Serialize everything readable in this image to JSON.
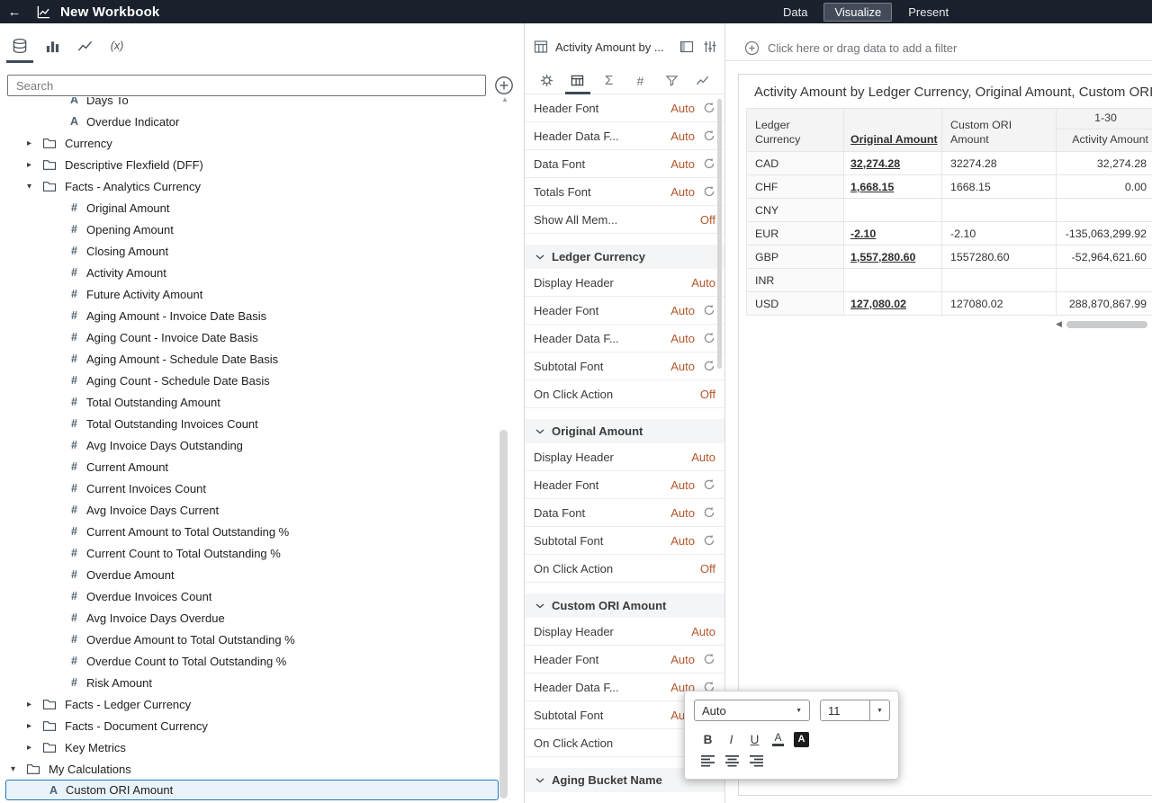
{
  "icons": {
    "back": "←",
    "expand": "▸",
    "collapse": "▾",
    "dropdown": "▼",
    "scroll_up": "▲",
    "scroll_left": "◀",
    "measure": "#",
    "attribute": "A",
    "fx": "(x)",
    "sigma": "Σ",
    "hash": "#"
  },
  "accent_colors": {
    "value_orange": "#b2572b",
    "selection_blue": "#2379bf",
    "topbar": "#1b212c"
  },
  "topbar": {
    "title": "New Workbook",
    "nav": [
      {
        "label": "Data",
        "active": false
      },
      {
        "label": "Visualize",
        "active": true
      },
      {
        "label": "Present",
        "active": false
      }
    ]
  },
  "data_panel": {
    "search_placeholder": "Search",
    "tree": [
      {
        "kind": "attr",
        "label": "Days To",
        "pad": 76
      },
      {
        "kind": "attr",
        "label": "Overdue Indicator",
        "pad": 76
      },
      {
        "kind": "folder",
        "label": "Currency",
        "pad": 30,
        "expanded": false
      },
      {
        "kind": "folder",
        "label": "Descriptive Flexfield (DFF)",
        "pad": 30,
        "expanded": false
      },
      {
        "kind": "folder",
        "label": "Facts - Analytics Currency",
        "pad": 30,
        "expanded": true
      },
      {
        "kind": "measure",
        "label": "Original Amount",
        "pad": 76
      },
      {
        "kind": "measure",
        "label": "Opening Amount",
        "pad": 76
      },
      {
        "kind": "measure",
        "label": "Closing Amount",
        "pad": 76
      },
      {
        "kind": "measure",
        "label": "Activity Amount",
        "pad": 76
      },
      {
        "kind": "measure",
        "label": "Future Activity Amount",
        "pad": 76
      },
      {
        "kind": "measure",
        "label": "Aging Amount - Invoice Date Basis",
        "pad": 76
      },
      {
        "kind": "measure",
        "label": "Aging Count - Invoice Date Basis",
        "pad": 76
      },
      {
        "kind": "measure",
        "label": "Aging Amount - Schedule Date Basis",
        "pad": 76
      },
      {
        "kind": "measure",
        "label": "Aging Count - Schedule Date Basis",
        "pad": 76
      },
      {
        "kind": "measure",
        "label": "Total Outstanding Amount",
        "pad": 76
      },
      {
        "kind": "measure",
        "label": "Total Outstanding Invoices Count",
        "pad": 76
      },
      {
        "kind": "measure",
        "label": "Avg Invoice Days Outstanding",
        "pad": 76
      },
      {
        "kind": "measure",
        "label": "Current Amount",
        "pad": 76
      },
      {
        "kind": "measure",
        "label": "Current Invoices Count",
        "pad": 76
      },
      {
        "kind": "measure",
        "label": "Avg Invoice Days Current",
        "pad": 76
      },
      {
        "kind": "measure",
        "label": "Current Amount to Total Outstanding %",
        "pad": 76
      },
      {
        "kind": "measure",
        "label": "Current Count to Total Outstanding %",
        "pad": 76
      },
      {
        "kind": "measure",
        "label": "Overdue Amount",
        "pad": 76
      },
      {
        "kind": "measure",
        "label": "Overdue Invoices Count",
        "pad": 76
      },
      {
        "kind": "measure",
        "label": "Avg Invoice Days Overdue",
        "pad": 76
      },
      {
        "kind": "measure",
        "label": "Overdue Amount to Total Outstanding %",
        "pad": 76
      },
      {
        "kind": "measure",
        "label": "Overdue Count to Total Outstanding %",
        "pad": 76
      },
      {
        "kind": "measure",
        "label": "Risk Amount",
        "pad": 76
      },
      {
        "kind": "folder",
        "label": "Facts - Ledger Currency",
        "pad": 30,
        "expanded": false
      },
      {
        "kind": "folder",
        "label": "Facts - Document Currency",
        "pad": 30,
        "expanded": false
      },
      {
        "kind": "folder",
        "label": "Key Metrics",
        "pad": 30,
        "expanded": false
      },
      {
        "kind": "folder",
        "label": "My Calculations",
        "pad": 12,
        "expanded": true
      },
      {
        "kind": "attr",
        "label": "Custom ORI Amount",
        "pad": 52,
        "selected": true
      }
    ]
  },
  "props_panel": {
    "viz_title": "Activity Amount by ...",
    "rows": [
      {
        "t": "prop",
        "label": "Header Font",
        "value": "Auto",
        "reset": true
      },
      {
        "t": "prop",
        "label": "Header Data F...",
        "value": "Auto",
        "reset": true
      },
      {
        "t": "prop",
        "label": "Data Font",
        "value": "Auto",
        "reset": true
      },
      {
        "t": "prop",
        "label": "Totals Font",
        "value": "Auto",
        "reset": true
      },
      {
        "t": "prop",
        "label": "Show All Mem...",
        "value": "Off",
        "reset": false
      },
      {
        "t": "section",
        "label": "Ledger Currency"
      },
      {
        "t": "prop",
        "label": "Display Header",
        "value": "Auto",
        "reset": false
      },
      {
        "t": "prop",
        "label": "Header Font",
        "value": "Auto",
        "reset": true
      },
      {
        "t": "prop",
        "label": "Header Data F...",
        "value": "Auto",
        "reset": true
      },
      {
        "t": "prop",
        "label": "Subtotal Font",
        "value": "Auto",
        "reset": true
      },
      {
        "t": "prop",
        "label": "On Click Action",
        "value": "Off",
        "reset": false
      },
      {
        "t": "section",
        "label": "Original Amount"
      },
      {
        "t": "prop",
        "label": "Display Header",
        "value": "Auto",
        "reset": false
      },
      {
        "t": "prop",
        "label": "Header Font",
        "value": "Auto",
        "reset": true
      },
      {
        "t": "prop",
        "label": "Data Font",
        "value": "Auto",
        "reset": true
      },
      {
        "t": "prop",
        "label": "Subtotal Font",
        "value": "Auto",
        "reset": true
      },
      {
        "t": "prop",
        "label": "On Click Action",
        "value": "Off",
        "reset": false
      },
      {
        "t": "section",
        "label": "Custom ORI Amount"
      },
      {
        "t": "prop",
        "label": "Display Header",
        "value": "Auto",
        "reset": false
      },
      {
        "t": "prop",
        "label": "Header Font",
        "value": "Auto",
        "reset": true
      },
      {
        "t": "prop",
        "label": "Header Data F...",
        "value": "Auto",
        "reset": true
      },
      {
        "t": "prop",
        "label": "Subtotal Font",
        "value": "Auto",
        "reset": true
      },
      {
        "t": "prop",
        "label": "On Click Action",
        "value": "",
        "reset": false
      },
      {
        "t": "section",
        "label": "Aging Bucket Name"
      }
    ]
  },
  "canvas": {
    "filter_placeholder": "Click here or drag data to add a filter",
    "viz": {
      "title": "Activity Amount by Ledger Currency, Original Amount, Custom ORI Amount",
      "table": {
        "group_header": "1-30",
        "col_headers": [
          "Ledger Currency",
          "Original Amount",
          "Custom ORI Amount",
          "Activity Amount"
        ],
        "rows": [
          [
            "CAD",
            "32,274.28",
            "32274.28",
            "32,274.28"
          ],
          [
            "CHF",
            "1,668.15",
            "1668.15",
            "0.00"
          ],
          [
            "CNY",
            "",
            "",
            ""
          ],
          [
            "EUR",
            "-2.10",
            "-2.10",
            "-135,063,299.92"
          ],
          [
            "GBP",
            "1,557,280.60",
            "1557280.60",
            "-52,964,621.60"
          ],
          [
            "INR",
            "",
            "",
            ""
          ],
          [
            "USD",
            "127,080.02",
            "127080.02",
            "288,870,867.99"
          ]
        ]
      }
    }
  },
  "font_popup": {
    "font_family": "Auto",
    "font_size": "11",
    "bold": "B",
    "italic": "I",
    "underline": "U",
    "color_letter": "A"
  }
}
